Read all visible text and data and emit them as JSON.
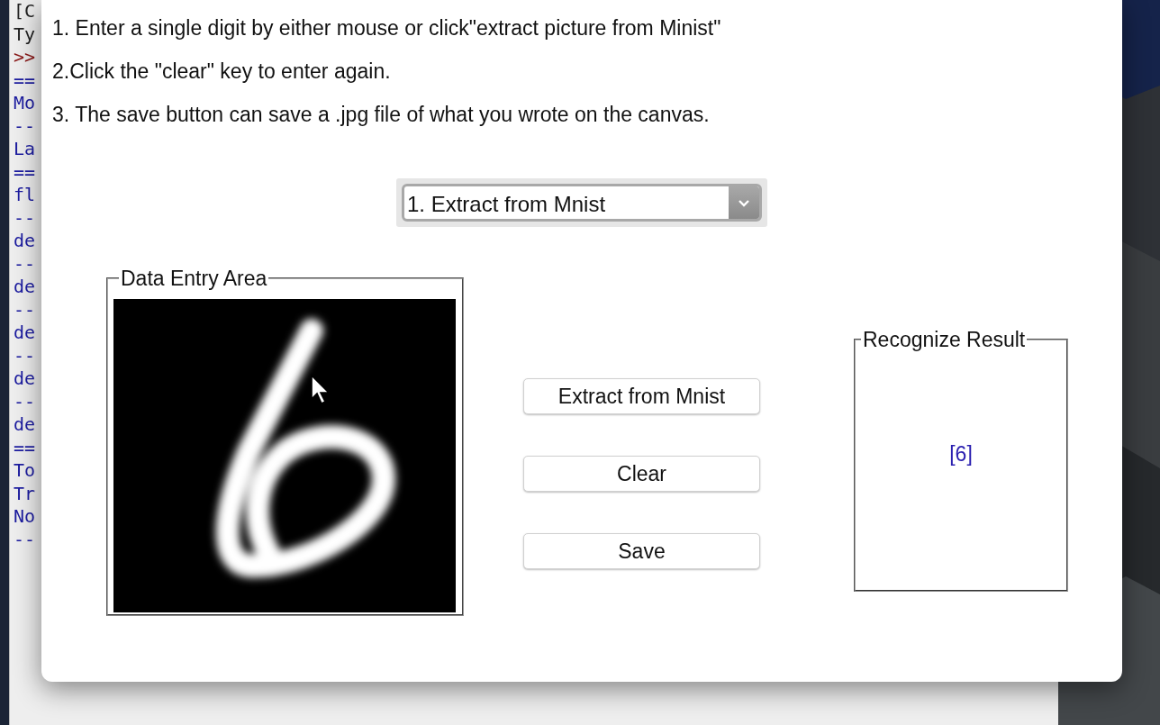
{
  "terminal": {
    "lines": [
      {
        "text": "[C",
        "kind": "plain"
      },
      {
        "text": "Ty",
        "kind": "plain"
      },
      {
        "text": ">>",
        "kind": "prompt"
      },
      {
        "text": "==",
        "kind": "output"
      },
      {
        "text": "Mo",
        "kind": "output"
      },
      {
        "text": "--",
        "kind": "output"
      },
      {
        "text": "La",
        "kind": "output"
      },
      {
        "text": "==",
        "kind": "output"
      },
      {
        "text": "fl",
        "kind": "output"
      },
      {
        "text": "--",
        "kind": "output"
      },
      {
        "text": "de",
        "kind": "output"
      },
      {
        "text": "--",
        "kind": "output"
      },
      {
        "text": "de",
        "kind": "output"
      },
      {
        "text": "--",
        "kind": "output"
      },
      {
        "text": "de",
        "kind": "output"
      },
      {
        "text": "--",
        "kind": "output"
      },
      {
        "text": "de",
        "kind": "output"
      },
      {
        "text": "--",
        "kind": "output"
      },
      {
        "text": "de",
        "kind": "output"
      },
      {
        "text": "==",
        "kind": "output"
      },
      {
        "text": "To",
        "kind": "output"
      },
      {
        "text": "Tr",
        "kind": "output"
      },
      {
        "text": "No",
        "kind": "output"
      },
      {
        "text": "--",
        "kind": "output"
      }
    ]
  },
  "dialog": {
    "instructions": [
      "1. Enter a single digit by either mouse or click\"extract picture from Minist\"",
      "2.Click the \"clear\" key to enter again.",
      "3. The save button can save a .jpg file of what you wrote on the canvas."
    ],
    "mode_select": {
      "value": "1. Extract from Mnist"
    },
    "entry_area": {
      "title": "Data Entry Area"
    },
    "buttons": [
      "Extract from Mnist",
      "Clear",
      "Save"
    ],
    "result": {
      "title": "Recognize Result",
      "value": "[6]"
    }
  }
}
